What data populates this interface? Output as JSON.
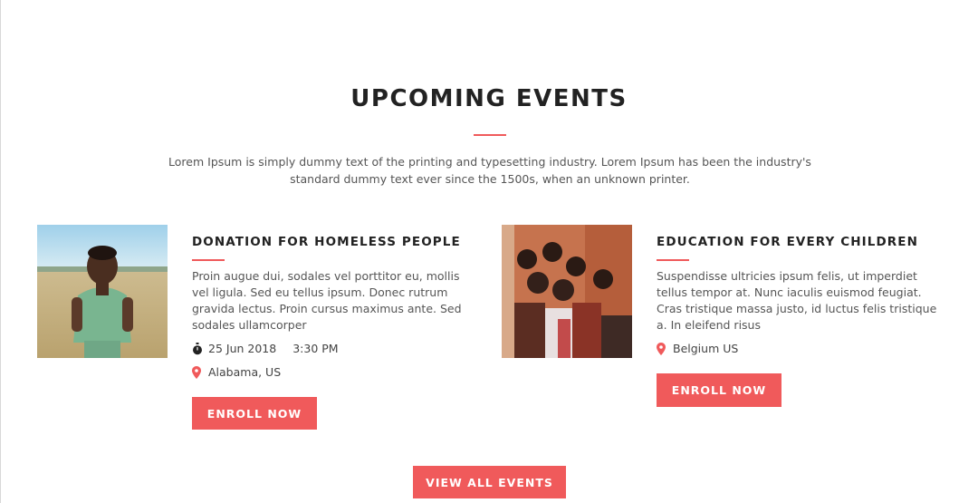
{
  "section": {
    "title": "UPCOMING EVENTS",
    "intro": "Lorem Ipsum is simply dummy text of the printing and typesetting industry. Lorem Ipsum has been the industry's standard dummy text ever since the 1500s, when an unknown printer."
  },
  "events": [
    {
      "title": "DONATION FOR HOMELESS PEOPLE",
      "description": "Proin augue dui, sodales vel porttitor eu, mollis vel ligula. Sed eu tellus ipsum. Donec rutrum gravida lectus. Proin cursus maximus ante. Sed sodales ullamcorper",
      "date": "25 Jun 2018",
      "time": "3:30 PM",
      "location": "Alabama, US",
      "button_label": "ENROLL NOW"
    },
    {
      "title": "EDUCATION FOR EVERY CHILDREN",
      "description": "Suspendisse ultricies ipsum felis, ut imperdiet tellus tempor at. Nunc iaculis euismod feugiat. Cras tristique massa justo, id luctus felis tristique a. In eleifend risus",
      "location": "Belgium US",
      "button_label": "ENROLL NOW"
    }
  ],
  "footer": {
    "view_all_label": "VIEW ALL EVENTS"
  },
  "colors": {
    "accent": "#f05a5b",
    "heading": "#222222",
    "body_text": "#555555"
  },
  "icons": {
    "date": "stopwatch-icon",
    "location": "map-pin-icon"
  }
}
